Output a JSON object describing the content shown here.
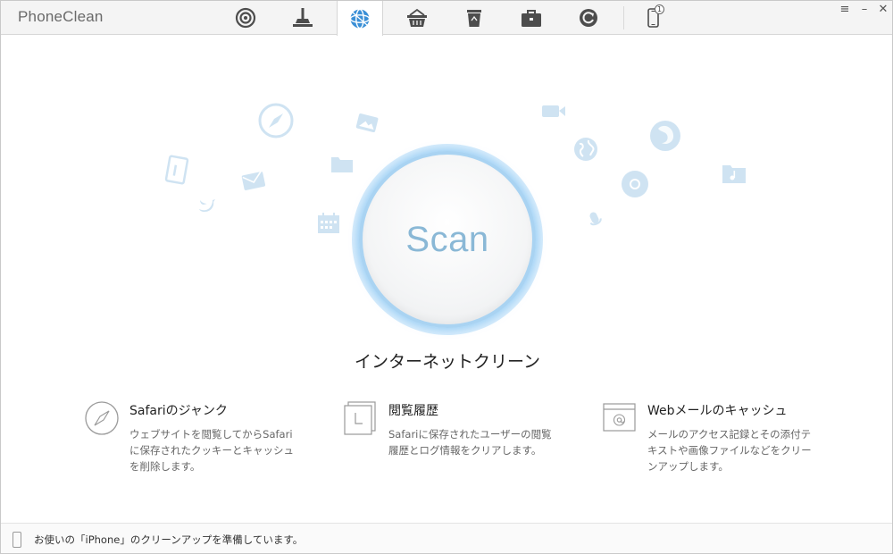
{
  "app": {
    "title": "PhoneClean"
  },
  "toolbar": {
    "tabs": [
      {
        "icon": "radar-icon",
        "label": ""
      },
      {
        "icon": "broom-icon",
        "label": ""
      },
      {
        "icon": "globe-icon",
        "label": "",
        "active": true
      },
      {
        "icon": "basket-icon",
        "label": ""
      },
      {
        "icon": "recycle-bin-icon",
        "label": ""
      },
      {
        "icon": "toolbox-icon",
        "label": ""
      },
      {
        "icon": "refresh-icon",
        "label": ""
      }
    ],
    "device_badge": "1"
  },
  "window_controls": {
    "menu": "≡",
    "minimize": "–",
    "close": "✕"
  },
  "main": {
    "scan_label": "Scan",
    "section_title": "インターネットクリーン",
    "features": [
      {
        "icon": "compass-icon",
        "title": "Safariのジャンク",
        "description": "ウェブサイトを閲覧してからSafariに保存されたクッキーとキャッシュを削除します。"
      },
      {
        "icon": "history-pages-icon",
        "title": "閲覧履歴",
        "description": "Safariに保存されたユーザーの閲覧履歴とログ情報をクリアします。"
      },
      {
        "icon": "webmail-icon",
        "title": "Webメールのキャッシュ",
        "description": "メールのアクセス記録とその添付テキストや画像ファイルなどをクリーンアップします。"
      }
    ]
  },
  "statusbar": {
    "text": "お使いの「iPhone」のクリーンアップを準備しています。"
  },
  "colors": {
    "accent": "#3a8fd6",
    "scan_ring": "#a9d3f2",
    "scan_text": "#8ab8d6",
    "decor_icon": "#a8cde8"
  }
}
